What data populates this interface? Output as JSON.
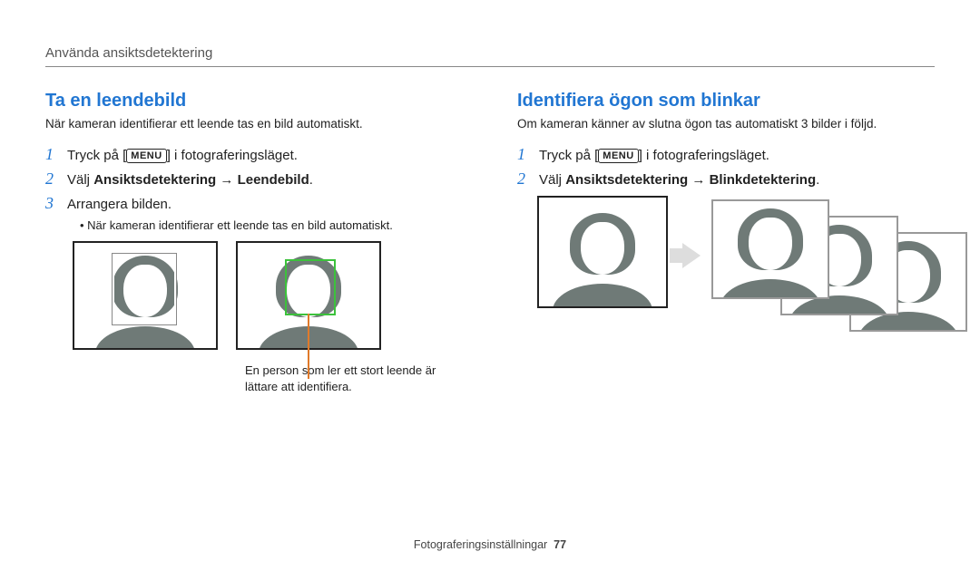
{
  "header": "Använda ansiktsdetektering",
  "left": {
    "title": "Ta en leendebild",
    "desc": "När kameran identifierar ett leende tas en bild automatiskt.",
    "steps": [
      {
        "pre": "Tryck på [",
        "menu": "MENU",
        "post": "] i fotograferingsläget."
      },
      {
        "html": "Välj <b>Ansiktsdetektering</b> → <b>Leendebild</b>."
      },
      {
        "text": "Arrangera bilden."
      }
    ],
    "sub": "När kameran identifierar ett leende tas en bild automatiskt.",
    "caption": "En person som ler ett stort leende är lättare att identifiera."
  },
  "right": {
    "title": "Identifiera ögon som blinkar",
    "desc": "Om kameran känner av slutna ögon tas automatiskt 3 bilder i följd.",
    "steps": [
      {
        "pre": "Tryck på [",
        "menu": "MENU",
        "post": "] i fotograferingsläget."
      },
      {
        "html": "Välj <b>Ansiktsdetektering</b> → <b>Blinkdetektering</b>."
      }
    ]
  },
  "footer": {
    "label": "Fotograferingsinställningar",
    "page": "77"
  }
}
